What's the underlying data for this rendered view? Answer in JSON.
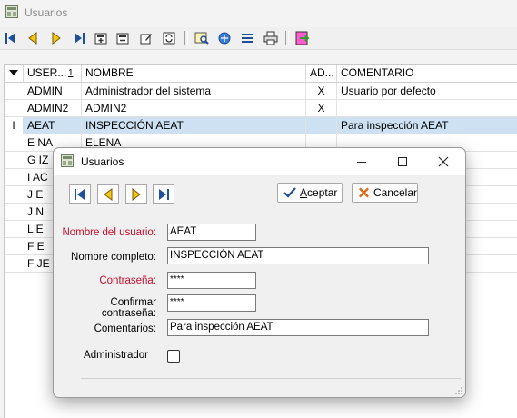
{
  "main_window": {
    "title": "Usuarios",
    "toolbar": {
      "buttons": [
        "first-record-icon",
        "prev-record-icon",
        "next-record-icon",
        "last-record-icon",
        "insert-record-icon",
        "delete-record-icon",
        "edit-record-icon",
        "refresh-icon",
        "find-icon",
        "filter-icon",
        "sort-icon",
        "print-icon",
        "export-icon"
      ]
    }
  },
  "grid": {
    "columns": {
      "user": "USER...",
      "sort_badge": "1",
      "name": "NOMBRE",
      "admin": "AD...",
      "comment": "COMENTARIO"
    },
    "rows": [
      {
        "user": "ADMIN",
        "name": "Administrador del sistema",
        "admin": "X",
        "comment": "Usuario por defecto"
      },
      {
        "user": "ADMIN2",
        "name": "ADMIN2",
        "admin": "X",
        "comment": ""
      },
      {
        "user": "AEAT",
        "name": "INSPECCIÓN AEAT",
        "admin": "",
        "comment": "Para inspección AEAT",
        "indicator": "I"
      },
      {
        "user": "E    NA",
        "name": "ELENA",
        "admin": "",
        "comment": ""
      },
      {
        "user": "G    IZ",
        "name": "",
        "admin": "",
        "comment": ""
      },
      {
        "user": "I    AC",
        "name": "",
        "admin": "",
        "comment": ""
      },
      {
        "user": "J    E",
        "name": "",
        "admin": "",
        "comment": ""
      },
      {
        "user": "J    N",
        "name": "",
        "admin": "",
        "comment": ""
      },
      {
        "user": "L    E",
        "name": "",
        "admin": "",
        "comment": ""
      },
      {
        "user": "F    E",
        "name": "",
        "admin": "",
        "comment": ""
      },
      {
        "user": "F    JE",
        "name": "",
        "admin": "",
        "comment": ""
      }
    ]
  },
  "dialog": {
    "title": "Usuarios",
    "accept_label_u": "A",
    "accept_label_rest": "ceptar",
    "cancel_label": "Cancelar",
    "fields": {
      "username_label": "Nombre del usuario:",
      "username_value": "AEAT",
      "fullname_label": "Nombre completo:",
      "fullname_value": "INSPECCIÓN AEAT",
      "password_label": "Contraseña:",
      "password_value": "****",
      "confirm_label": "Confirmar contraseña:",
      "confirm_value": "****",
      "comments_label": "Comentarios:",
      "comments_value": "Para inspección AEAT",
      "admin_label": "Administrador",
      "admin_checked": false
    }
  },
  "colors": {
    "required_label": "#c8102e",
    "selected_row": "#cde1f2",
    "nav_icon_blue": "#1e4f9a",
    "nav_icon_yellow": "#f5c518"
  }
}
